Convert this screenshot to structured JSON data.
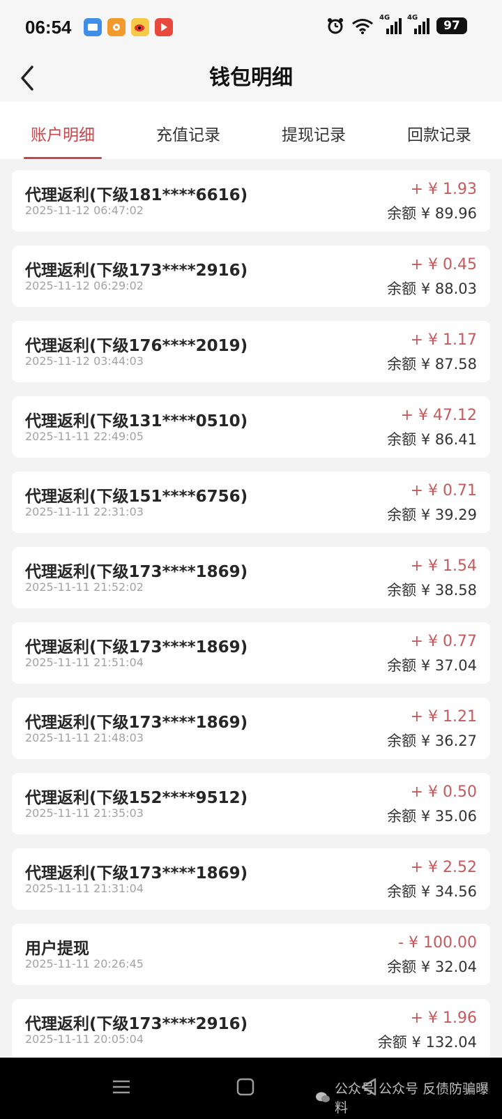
{
  "status_bar": {
    "time": "06:54",
    "signal1_label": "4G",
    "signal2_label": "4G",
    "battery": "97",
    "app_icons": [
      "blue-app-icon",
      "orange-app-icon",
      "weibo-icon",
      "video-app-icon"
    ]
  },
  "header": {
    "title": "钱包明细"
  },
  "tabs": [
    {
      "label": "账户明细",
      "active": true
    },
    {
      "label": "充值记录",
      "active": false
    },
    {
      "label": "提现记录",
      "active": false
    },
    {
      "label": "回款记录",
      "active": false
    }
  ],
  "transactions": [
    {
      "title": "代理返利(下级181****6616)",
      "time": "2025-11-12 06:47:02",
      "amount": "+ ¥ 1.93",
      "balance": "余额 ¥ 89.96"
    },
    {
      "title": "代理返利(下级173****2916)",
      "time": "2025-11-12 06:29:02",
      "amount": "+ ¥ 0.45",
      "balance": "余额 ¥ 88.03"
    },
    {
      "title": "代理返利(下级176****2019)",
      "time": "2025-11-12 03:44:03",
      "amount": "+ ¥ 1.17",
      "balance": "余额 ¥ 87.58"
    },
    {
      "title": "代理返利(下级131****0510)",
      "time": "2025-11-11 22:49:05",
      "amount": "+ ¥ 47.12",
      "balance": "余额 ¥ 86.41"
    },
    {
      "title": "代理返利(下级151****6756)",
      "time": "2025-11-11 22:31:03",
      "amount": "+ ¥ 0.71",
      "balance": "余额 ¥ 39.29"
    },
    {
      "title": "代理返利(下级173****1869)",
      "time": "2025-11-11 21:52:02",
      "amount": "+ ¥ 1.54",
      "balance": "余额 ¥ 38.58"
    },
    {
      "title": "代理返利(下级173****1869)",
      "time": "2025-11-11 21:51:04",
      "amount": "+ ¥ 0.77",
      "balance": "余额 ¥ 37.04"
    },
    {
      "title": "代理返利(下级173****1869)",
      "time": "2025-11-11 21:48:03",
      "amount": "+ ¥ 1.21",
      "balance": "余额 ¥ 36.27"
    },
    {
      "title": "代理返利(下级152****9512)",
      "time": "2025-11-11 21:35:03",
      "amount": "+ ¥ 0.50",
      "balance": "余额 ¥ 35.06"
    },
    {
      "title": "代理返利(下级173****1869)",
      "time": "2025-11-11 21:31:04",
      "amount": "+ ¥ 2.52",
      "balance": "余额 ¥ 34.56"
    },
    {
      "title": "用户提现",
      "time": "2025-11-11 20:26:45",
      "amount": "- ¥ 100.00",
      "balance": "余额 ¥ 32.04"
    },
    {
      "title": "代理返利(下级173****2916)",
      "time": "2025-11-11 20:05:04",
      "amount": "+ ¥ 1.96",
      "balance": "余额 ¥ 132.04"
    }
  ],
  "nav_bar": {
    "watermark": "公众号 公众号 反债防骗曝料"
  },
  "colors": {
    "accent": "#c6474a",
    "amount": "#c55a5c",
    "background": "#f3f3f3",
    "card": "#ffffff"
  }
}
